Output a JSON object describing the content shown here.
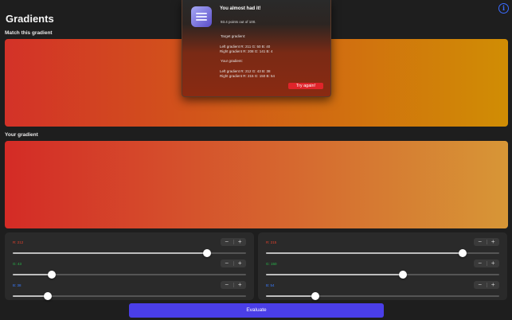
{
  "app": {
    "title": "Gradients",
    "info_icon": "info-icon"
  },
  "target": {
    "label": "Match this gradient",
    "left": "#d33228",
    "right": "#d08d04"
  },
  "user": {
    "label": "Your gradient",
    "left": "#d42b26",
    "right": "#d79636"
  },
  "controls": {
    "left": [
      {
        "label": "R: 212",
        "value": 212,
        "color": "#e0402b"
      },
      {
        "label": "G: 43",
        "value": 43,
        "color": "#28b84a"
      },
      {
        "label": "B: 38",
        "value": 38,
        "color": "#3a7bff"
      }
    ],
    "right": [
      {
        "label": "R: 215",
        "value": 215,
        "color": "#e0402b"
      },
      {
        "label": "G: 150",
        "value": 150,
        "color": "#28b84a"
      },
      {
        "label": "B: 54",
        "value": 54,
        "color": "#3a7bff"
      }
    ],
    "stepper_minus": "−",
    "stepper_plus": "+"
  },
  "evaluate_label": "Evaluate",
  "alert": {
    "title": "You almost had it!",
    "score": "93.4 points out of 100.",
    "target_heading": "Target gradient:",
    "target_left": "Left gradient  R: 211  G: 50  B: 40",
    "target_right": "Right gradient  R: 208  G: 141  B: 4",
    "your_heading": "Your gradient:",
    "your_left": "Left gradient  R: 212  G: 43  B: 38",
    "your_right": "Right gradient  R: 215  G: 150  B: 54",
    "button": "Try again!"
  }
}
